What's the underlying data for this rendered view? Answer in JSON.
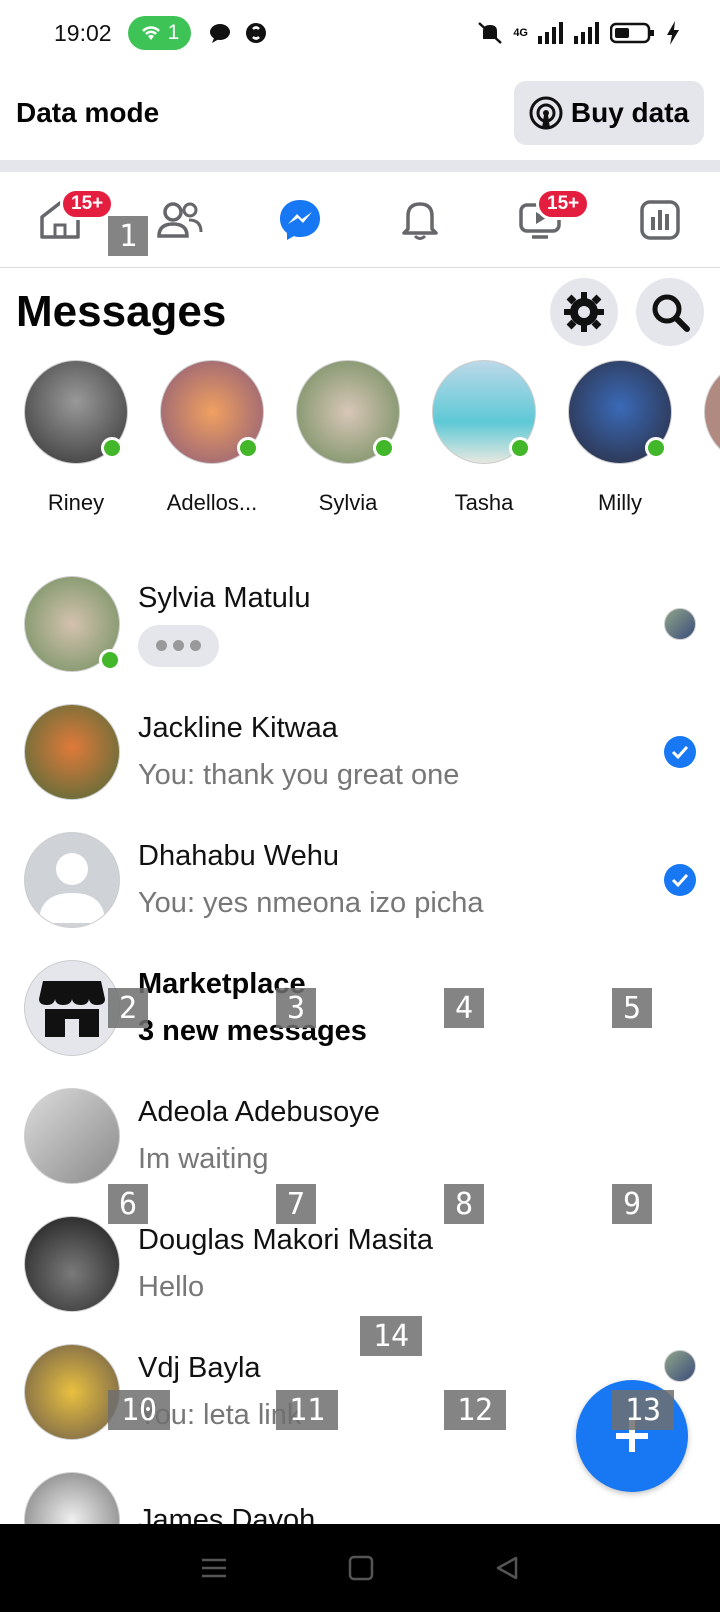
{
  "status_bar": {
    "time": "19:02",
    "wifi_count": "1",
    "network": "4G"
  },
  "data_mode": {
    "title": "Data mode",
    "buy_label": "Buy data"
  },
  "nav": {
    "home_badge": "15+",
    "video_badge": "15+"
  },
  "messages": {
    "title": "Messages"
  },
  "stories": [
    {
      "name": "Riney",
      "color": "#6f6f6f",
      "online": true
    },
    {
      "name": "Adellos...",
      "color": "#c77b4a",
      "online": true
    },
    {
      "name": "Sylvia",
      "color": "#9bb48d",
      "online": true
    },
    {
      "name": "Tasha",
      "color": "#5ec9d6",
      "online": true
    },
    {
      "name": "Milly",
      "color": "#4a4e7a",
      "online": true
    }
  ],
  "chats": [
    {
      "name": "Sylvia Matulu",
      "preview": "",
      "typing": true,
      "status": "seen",
      "color": "#a7b89a",
      "online": true,
      "bold": false
    },
    {
      "name": "Jackline Kitwaa",
      "preview": "You: thank you great one",
      "typing": false,
      "status": "check",
      "color": "#6a8a4a",
      "online": false,
      "bold": false
    },
    {
      "name": "Dhahabu Wehu",
      "preview": "You: yes nmeona izo picha",
      "typing": false,
      "status": "check",
      "color": "#cfd3d8",
      "online": false,
      "bold": false,
      "placeholder": true
    },
    {
      "name": "Marketplace",
      "preview": "3 new messages",
      "typing": false,
      "status": "",
      "color": "#e4e6eb",
      "online": false,
      "bold": true,
      "store": true
    },
    {
      "name": "Adeola Adebusoye",
      "preview": "Im waiting",
      "typing": false,
      "status": "",
      "color": "#bfc3c8",
      "online": false,
      "bold": false
    },
    {
      "name": "Douglas Makori Masita",
      "preview": "Hello",
      "typing": false,
      "status": "",
      "color": "#3a3a3a",
      "online": false,
      "bold": false
    },
    {
      "name": "Vdj Bayla",
      "preview": "You: leta link",
      "typing": false,
      "status": "seen",
      "color": "#c7a76a",
      "online": false,
      "bold": false
    },
    {
      "name": "James Davoh",
      "preview": "",
      "typing": false,
      "status": "check",
      "color": "#d9d9d9",
      "online": false,
      "bold": false
    }
  ],
  "markers": [
    "1",
    "2",
    "3",
    "4",
    "5",
    "6",
    "7",
    "8",
    "9",
    "10",
    "11",
    "12",
    "13",
    "14"
  ]
}
